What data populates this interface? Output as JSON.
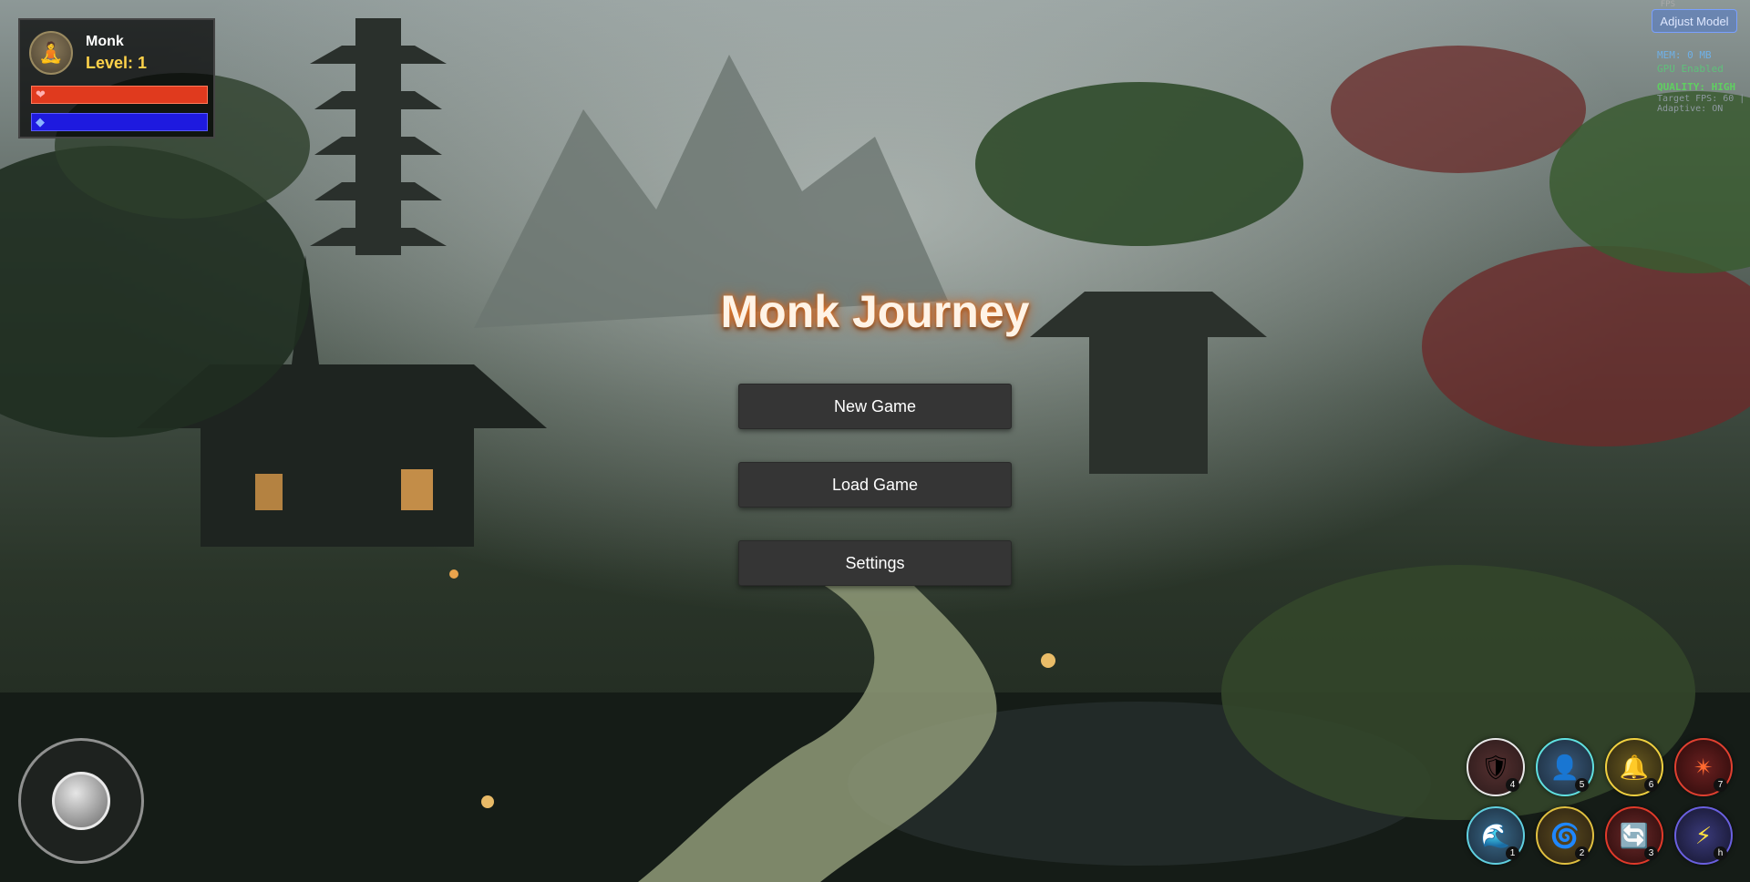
{
  "game": {
    "title": "Monk Journey"
  },
  "player": {
    "name": "Monk",
    "level_text": "Level: 1",
    "avatar_icon": "meditating-monk-icon",
    "health_fraction": 1.0,
    "mana_fraction": 1.0,
    "health_icon": "heart-icon",
    "mana_icon": "diamond-icon",
    "health_color": "#e03a1e",
    "mana_color": "#1e1adf"
  },
  "menu": {
    "new_game": "New Game",
    "load_game": "Load Game",
    "settings": "Settings"
  },
  "debug": {
    "fps_label": "FPS",
    "adjust_model": "Adjust Model",
    "mem": "MEM: 0 MB",
    "gpu": "GPU Enabled",
    "quality": "QUALITY: HIGH",
    "target_fps": "Target FPS: 60 |",
    "adaptive": "Adaptive: ON"
  },
  "skills": [
    {
      "key": "4",
      "icon": "shield-icon",
      "glyph": "🛡"
    },
    {
      "key": "5",
      "icon": "figure-icon",
      "glyph": "👤"
    },
    {
      "key": "6",
      "icon": "bell-icon",
      "glyph": "🔔"
    },
    {
      "key": "7",
      "icon": "explosion-icon",
      "glyph": "✴"
    },
    {
      "key": "1",
      "icon": "wave-icon",
      "glyph": "🌊"
    },
    {
      "key": "2",
      "icon": "spiral-icon",
      "glyph": "🌀"
    },
    {
      "key": "3",
      "icon": "cycle-icon",
      "glyph": "🔄"
    },
    {
      "key": "h",
      "icon": "lightning-icon",
      "glyph": "⚡"
    }
  ]
}
